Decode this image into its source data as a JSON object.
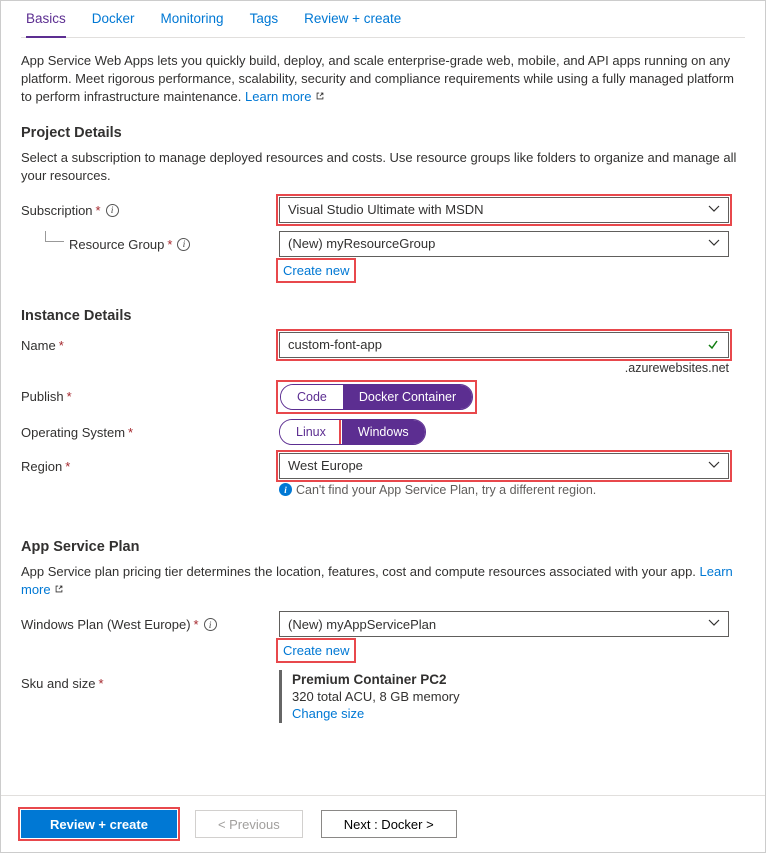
{
  "tabs": {
    "basics": "Basics",
    "docker": "Docker",
    "monitoring": "Monitoring",
    "tags": "Tags",
    "review": "Review + create"
  },
  "intro": {
    "text": "App Service Web Apps lets you quickly build, deploy, and scale enterprise-grade web, mobile, and API apps running on any platform. Meet rigorous performance, scalability, security and compliance requirements while using a fully managed platform to perform infrastructure maintenance.  ",
    "learn": "Learn more"
  },
  "project": {
    "heading": "Project Details",
    "desc": "Select a subscription to manage deployed resources and costs. Use resource groups like folders to organize and manage all your resources.",
    "subscription_label": "Subscription",
    "subscription_value": "Visual Studio Ultimate with MSDN",
    "rg_label": "Resource Group",
    "rg_value": "(New) myResourceGroup",
    "create_new": "Create new"
  },
  "instance": {
    "heading": "Instance Details",
    "name_label": "Name",
    "name_value": "custom-font-app",
    "suffix": ".azurewebsites.net",
    "publish_label": "Publish",
    "publish_code": "Code",
    "publish_docker": "Docker Container",
    "os_label": "Operating System",
    "os_linux": "Linux",
    "os_windows": "Windows",
    "region_label": "Region",
    "region_value": "West Europe",
    "region_hint": "Can't find your App Service Plan, try a different region."
  },
  "plan": {
    "heading": "App Service Plan",
    "desc": "App Service plan pricing tier determines the location, features, cost and compute resources associated with your app. ",
    "learn": "Learn more",
    "winplan_label": "Windows Plan (West Europe)",
    "winplan_value": "(New) myAppServicePlan",
    "create_new": "Create new",
    "sku_label": "Sku and size",
    "sku_title": "Premium Container PC2",
    "sku_detail": "320 total ACU, 8 GB memory",
    "change_size": "Change size"
  },
  "footer": {
    "review": "Review + create",
    "prev": "< Previous",
    "next": "Next : Docker >"
  }
}
